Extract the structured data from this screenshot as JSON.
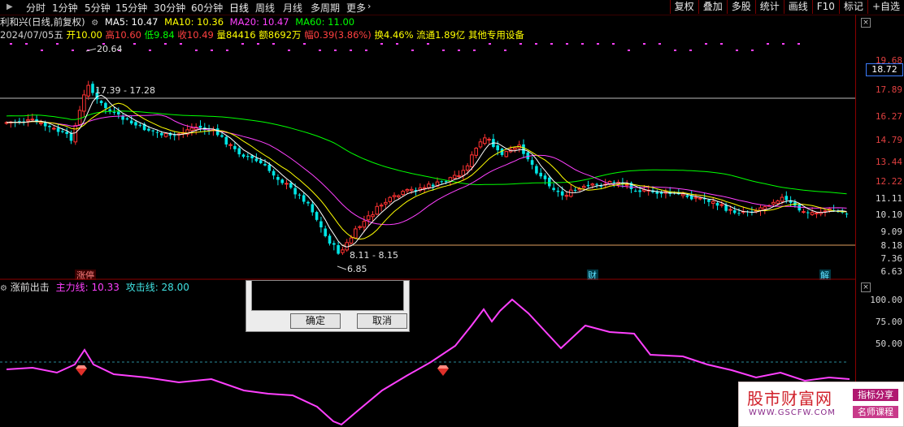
{
  "toolbar": {
    "tabs": [
      "分时",
      "1分钟",
      "5分钟",
      "15分钟",
      "30分钟",
      "60分钟",
      "日线",
      "周线",
      "月线",
      "多周期",
      "更多"
    ],
    "active_tab": "日线",
    "right_buttons": [
      "复权",
      "叠加",
      "多股",
      "统计",
      "画线",
      "F10",
      "标记",
      "+自选"
    ]
  },
  "legend": {
    "title": "利和兴(日线,前复权)",
    "ma5": "MA5: 10.47",
    "ma10": "MA10: 10.36",
    "ma20": "MA20: 10.47",
    "ma60": "MA60: 11.00"
  },
  "info": {
    "date": "2024/07/05五",
    "open": "开10.00",
    "high": "高10.60",
    "low": "低9.84",
    "close": "收10.49",
    "volume": "量84416",
    "amount": "额8692万",
    "change": "幅0.39(3.86%)",
    "turnover": "换4.46%",
    "float_cap": "流通1.89亿",
    "industry": "其他专用设备"
  },
  "price_axis": {
    "labels": [
      "19.68",
      "17.89",
      "16.27",
      "14.79",
      "13.44",
      "12.22",
      "11.11",
      "10.10",
      "9.09",
      "8.18",
      "7.36",
      "6.63"
    ],
    "current_price": "18.72"
  },
  "annotations": {
    "high_mark": "20.64",
    "upper_range": "17.39 - 17.28",
    "lower_range": "8.11 - 8.15",
    "low_mark": "6.85",
    "tag_limitup": "涨停",
    "tag_finance": "财",
    "tag_unlock": "解"
  },
  "indicator": {
    "name": "涨前出击",
    "main_line": "主力线: 10.33",
    "attack_line": "攻击线: 28.00",
    "axis_labels": [
      "100.00",
      "75.00",
      "50.00"
    ]
  },
  "dialog": {
    "ok_label": "确定",
    "cancel_label": "取消"
  },
  "watermark": {
    "site_name": "股市财富网",
    "url": "WWW.GSCFW.COM",
    "badge_top": "指标分享",
    "badge_bottom": "名师课程"
  },
  "colors": {
    "ma5": "#ffffff",
    "ma10": "#ffff00",
    "ma20": "#ff40ff",
    "ma60": "#00ff00",
    "up": "#ff3232",
    "down": "#00e5e5",
    "indicator_line": "#ff40ff"
  }
}
